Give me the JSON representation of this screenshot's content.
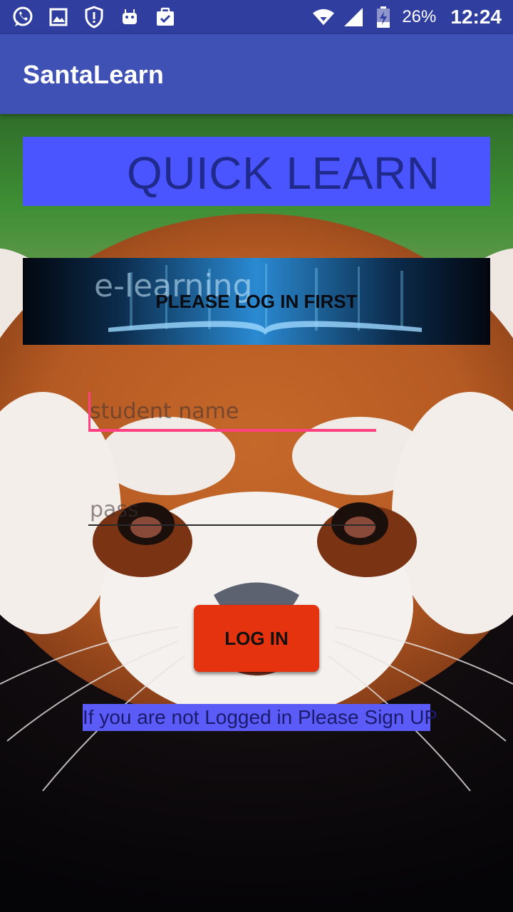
{
  "status_bar": {
    "icons": [
      "whatsapp-icon",
      "gallery-icon",
      "shield-alert-icon",
      "android-icon",
      "clipboard-check-icon"
    ],
    "right_icons": [
      "wifi-icon",
      "signal-icon",
      "battery-charging-icon"
    ],
    "battery": "26%",
    "time": "12:24"
  },
  "app_bar": {
    "title": "SantaLearn"
  },
  "banner": {
    "title": "QUICK LEARN",
    "color": "#4A55FF"
  },
  "elearning": {
    "image_text": "e-learning",
    "label": "PLEASE LOG IN FIRST"
  },
  "form": {
    "student_name": {
      "placeholder": "student name",
      "value": ""
    },
    "password": {
      "placeholder": "pass",
      "value": ""
    },
    "login_label": "LOG IN"
  },
  "signup_text": "If you are not Logged in Please Sign UP",
  "colors": {
    "status": "#303F9F",
    "primary": "#3F51B5",
    "accent": "#FF4081",
    "button": "#E5320F"
  }
}
